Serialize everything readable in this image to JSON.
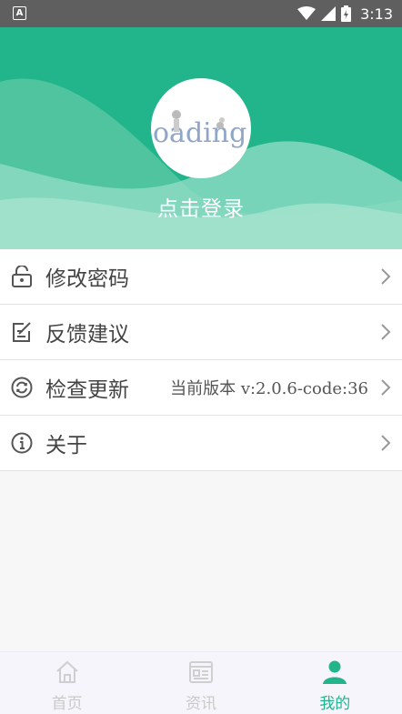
{
  "status_bar": {
    "left_icon": "A",
    "time": "3:13",
    "icons": [
      "wifi-icon",
      "signal-icon",
      "battery-icon"
    ]
  },
  "profile": {
    "avatar_text": "oading",
    "login_label": "点击登录",
    "accent_color": "#22b58b"
  },
  "menu": {
    "items": [
      {
        "label": "修改密码",
        "icon": "lock-icon",
        "value": ""
      },
      {
        "label": "反馈建议",
        "icon": "edit-icon",
        "value": ""
      },
      {
        "label": "检查更新",
        "icon": "refresh-icon",
        "value": "当前版本  v:2.0.6-code:36"
      },
      {
        "label": "关于",
        "icon": "info-icon",
        "value": ""
      }
    ]
  },
  "tabs": [
    {
      "label": "首页",
      "icon": "home-icon",
      "active": false
    },
    {
      "label": "资讯",
      "icon": "news-icon",
      "active": false
    },
    {
      "label": "我的",
      "icon": "person-icon",
      "active": true
    }
  ]
}
